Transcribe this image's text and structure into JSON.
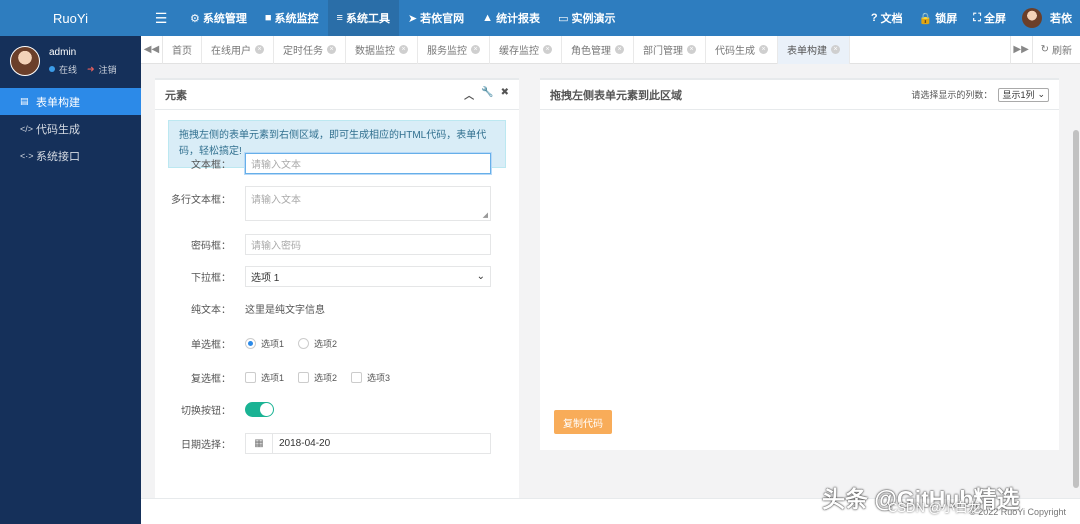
{
  "brand": "RuoYi",
  "user": {
    "name": "admin",
    "status": "在线",
    "logout": "注销"
  },
  "sidebar": {
    "items": [
      {
        "label": "表单构建",
        "icon": "▤"
      },
      {
        "label": "代码生成",
        "icon": "</>"
      },
      {
        "label": "系统接口",
        "icon": "<·>"
      }
    ]
  },
  "topnav": {
    "items": [
      {
        "label": "系统管理",
        "icon": "⚙"
      },
      {
        "label": "系统监控",
        "icon": "■"
      },
      {
        "label": "系统工具",
        "icon": "≡"
      },
      {
        "label": "若依官网",
        "icon": "➤"
      },
      {
        "label": "统计报表",
        "icon": "▲"
      },
      {
        "label": "实例演示",
        "icon": "▭"
      }
    ],
    "right": [
      {
        "label": "文档",
        "icon": "?"
      },
      {
        "label": "锁屏",
        "icon": "🔒"
      },
      {
        "label": "全屏",
        "icon": "⛶"
      }
    ],
    "user": "若依"
  },
  "tabs": {
    "items": [
      "首页",
      "在线用户",
      "定时任务",
      "数据监控",
      "服务监控",
      "缓存监控",
      "角色管理",
      "部门管理",
      "代码生成",
      "表单构建"
    ],
    "refresh": "刷新"
  },
  "left_panel": {
    "title": "元素",
    "alert": "拖拽左侧的表单元素到右侧区域，即可生成相应的HTML代码，表单代码，轻松搞定!",
    "fields": {
      "text_label": "文本框：",
      "text_placeholder": "请输入文本",
      "textarea_label": "多行文本框：",
      "textarea_placeholder": "请输入文本",
      "password_label": "密码框：",
      "password_placeholder": "请输入密码",
      "select_label": "下拉框：",
      "select_value": "选项 1",
      "static_label": "纯文本：",
      "static_value": "这里是纯文字信息",
      "radio_label": "单选框：",
      "radio_options": [
        "选项1",
        "选项2"
      ],
      "checkbox_label": "复选框：",
      "checkbox_options": [
        "选项1",
        "选项2",
        "选项3"
      ],
      "toggle_label": "切换按钮：",
      "date_label": "日期选择：",
      "date_value": "2018-04-20"
    }
  },
  "right_panel": {
    "title": "拖拽左侧表单元素到此区域",
    "columns_label": "请选择显示的列数：",
    "columns_value": "显示1列",
    "copy_button": "复制代码"
  },
  "footer": {
    "copyright": "© 2022 RuoYi Copyright"
  },
  "watermark": {
    "main": "头条 @GitHub精选",
    "sub": "CSDN @小白龙"
  }
}
